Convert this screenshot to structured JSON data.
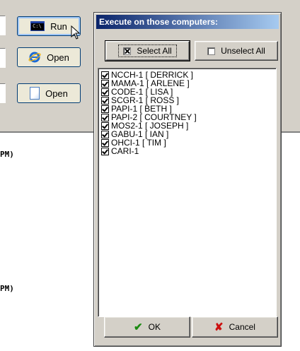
{
  "left_panel": {
    "run_button": {
      "label": "Run",
      "icon": "command-prompt-icon"
    },
    "open_button_1": {
      "label": "Open",
      "icon": "internet-explorer-icon"
    },
    "open_button_2": {
      "label": "Open",
      "icon": "document-icon"
    }
  },
  "text_area": {
    "line1": "PM)",
    "line2": "PM)"
  },
  "dialog": {
    "title": "Execute on those computers:",
    "select_all_label": "Select All",
    "unselect_all_label": "Unselect All",
    "computers": [
      {
        "label": "NCCH-1 [ DERRICK ]",
        "checked": true
      },
      {
        "label": "MAMA-1 [ ARLENE ]",
        "checked": true
      },
      {
        "label": "CODE-1 [ LISA ]",
        "checked": true
      },
      {
        "label": "SCGR-1 [ ROSS ]",
        "checked": true
      },
      {
        "label": "PAPI-1 [ BETH ]",
        "checked": true
      },
      {
        "label": "PAPI-2 [ COURTNEY ]",
        "checked": true
      },
      {
        "label": "MOS2-1 [ JOSEPH ]",
        "checked": true
      },
      {
        "label": "GABU-1 [ IAN ]",
        "checked": true
      },
      {
        "label": "OHCI-1 [ TIM ]",
        "checked": true
      },
      {
        "label": "CARI-1",
        "checked": true
      }
    ],
    "ok_label": "OK",
    "cancel_label": "Cancel"
  },
  "colors": {
    "title_bar_start": "#0a246a",
    "title_bar_end": "#a6caf0",
    "ok_icon": "#1a8a10",
    "cancel_icon": "#cc1010"
  }
}
